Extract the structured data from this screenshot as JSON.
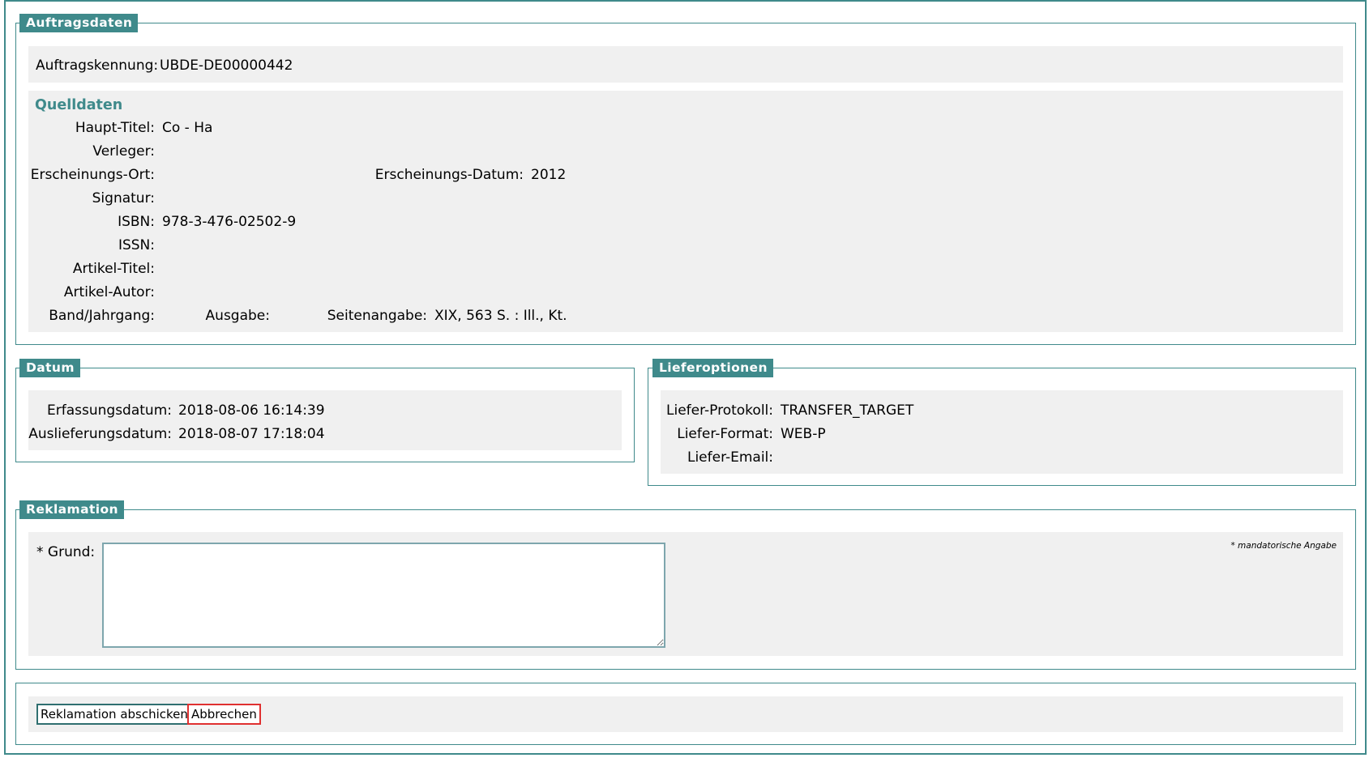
{
  "auftragsdaten": {
    "legend": "Auftragsdaten",
    "kennung_label": "Auftragskennung:",
    "kennung_value": "UBDE-DE00000442"
  },
  "quelldaten": {
    "title": "Quelldaten",
    "haupt_titel_label": "Haupt-Titel:",
    "haupt_titel_value": "Co - Ha",
    "verleger_label": "Verleger:",
    "verleger_value": "",
    "erscheinungs_ort_label": "Erscheinungs-Ort:",
    "erscheinungs_ort_value": "",
    "erscheinungs_datum_label": "Erscheinungs-Datum:",
    "erscheinungs_datum_value": "2012",
    "signatur_label": "Signatur:",
    "signatur_value": "",
    "isbn_label": "ISBN:",
    "isbn_value": "978-3-476-02502-9",
    "issn_label": "ISSN:",
    "issn_value": "",
    "artikel_titel_label": "Artikel-Titel:",
    "artikel_titel_value": "",
    "artikel_autor_label": "Artikel-Autor:",
    "artikel_autor_value": "",
    "band_label": "Band/Jahrgang:",
    "band_value": "",
    "ausgabe_label": "Ausgabe:",
    "ausgabe_value": "",
    "seitenangabe_label": "Seitenangabe:",
    "seitenangabe_value": "XIX, 563 S. : Ill., Kt."
  },
  "datum": {
    "legend": "Datum",
    "erfassung_label": "Erfassungsdatum:",
    "erfassung_value": "2018-08-06 16:14:39",
    "auslieferung_label": "Auslieferungsdatum:",
    "auslieferung_value": "2018-08-07 17:18:04"
  },
  "lieferoptionen": {
    "legend": "Lieferoptionen",
    "protokoll_label": "Liefer-Protokoll:",
    "protokoll_value": "TRANSFER_TARGET",
    "format_label": "Liefer-Format:",
    "format_value": "WEB-P",
    "email_label": "Liefer-Email:",
    "email_value": ""
  },
  "reklamation": {
    "legend": "Reklamation",
    "grund_label": "* Grund:",
    "grund_value": "",
    "mandatory_note": "* mandatorische Angabe"
  },
  "actions": {
    "submit_label": "Reklamation abschicken",
    "cancel_label": "Abbrechen"
  },
  "colors": {
    "accent": "#3f8a8b",
    "panel_bg": "#f0f0f0",
    "cancel_border": "#e03030"
  }
}
